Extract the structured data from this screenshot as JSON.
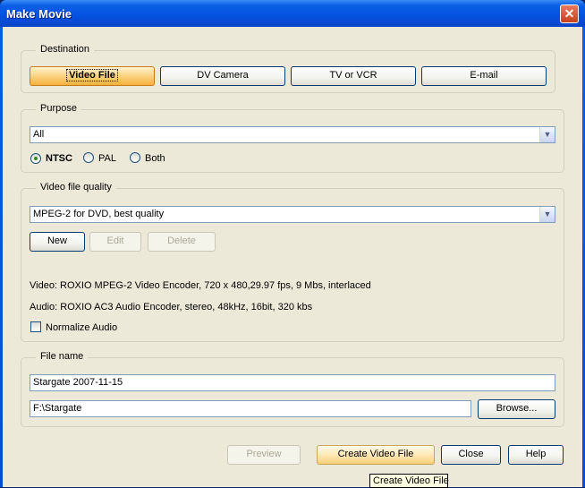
{
  "window": {
    "title": "Make Movie"
  },
  "destination": {
    "legend": "Destination",
    "buttons": [
      "Video File",
      "DV Camera",
      "TV or VCR",
      "E-mail"
    ]
  },
  "purpose": {
    "legend": "Purpose",
    "selected": "All",
    "radios": [
      "NTSC",
      "PAL",
      "Both"
    ],
    "checked": "NTSC"
  },
  "quality": {
    "legend": "Video file quality",
    "selected": "MPEG-2 for DVD, best quality",
    "new_label": "New",
    "edit_label": "Edit",
    "delete_label": "Delete",
    "video_info": "Video: ROXIO MPEG-2 Video Encoder, 720 x 480,29.97 fps, 9 Mbs, interlaced",
    "audio_info": "Audio: ROXIO AC3 Audio Encoder, stereo, 48kHz, 16bit, 320 kbs",
    "normalize_label": "Normalize Audio"
  },
  "filename": {
    "legend": "File name",
    "name_value": "Stargate 2007-11-15",
    "path_value": "F:\\Stargate",
    "browse_label": "Browse..."
  },
  "footer": {
    "preview_label": "Preview",
    "create_label": "Create Video File",
    "close_label": "Close",
    "help_label": "Help"
  },
  "tooltip": {
    "text": "Create Video File"
  }
}
